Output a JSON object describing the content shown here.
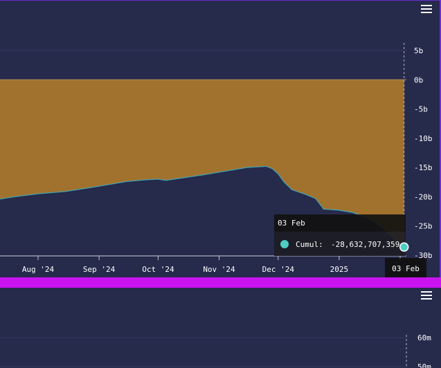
{
  "ui": {
    "menu_icon": "hamburger-icon",
    "colors": {
      "background": "#262a4b",
      "area_fill": "#a1722e",
      "series_fill": "#262a4b",
      "series_line": "#3fa7b8",
      "divider": "#c914f0",
      "tooltip_bg": "#111111",
      "marker": "#4ecdc4"
    }
  },
  "chart_data": [
    {
      "type": "area",
      "x_ticks": [
        "Aug '24",
        "Sep '24",
        "Oct '24",
        "Nov '24",
        "Dec '24",
        "2025",
        "Feb"
      ],
      "y_ticks": [
        "5b",
        "0b",
        "-5b",
        "-10b",
        "-15b",
        "-20b",
        "-25b",
        "-30b"
      ],
      "y_tick_values": [
        5,
        0,
        -5,
        -10,
        -15,
        -20,
        -25,
        -30
      ],
      "ylim": [
        -30,
        5
      ],
      "y_unit": "billions",
      "grid": true,
      "series": [
        {
          "points": [
            [
              "2024-07-12",
              -20.4
            ],
            [
              "2024-07-20",
              -20.0
            ],
            [
              "2024-08-01",
              -19.5
            ],
            [
              "2024-08-15",
              -19.1
            ],
            [
              "2024-09-01",
              -18.2
            ],
            [
              "2024-09-15",
              -17.4
            ],
            [
              "2024-09-25",
              -17.1
            ],
            [
              "2024-10-01",
              -17.0
            ],
            [
              "2024-10-05",
              -17.2
            ],
            [
              "2024-10-15",
              -16.7
            ],
            [
              "2024-10-25",
              -16.2
            ],
            [
              "2024-11-01",
              -15.8
            ],
            [
              "2024-11-10",
              -15.3
            ],
            [
              "2024-11-15",
              -15.0
            ],
            [
              "2024-11-20",
              -14.9
            ],
            [
              "2024-11-25",
              -14.8
            ],
            [
              "2024-11-28",
              -15.2
            ],
            [
              "2024-12-01",
              -16.1
            ],
            [
              "2024-12-04",
              -17.5
            ],
            [
              "2024-12-08",
              -18.8
            ],
            [
              "2024-12-15",
              -19.6
            ],
            [
              "2024-12-20",
              -20.3
            ],
            [
              "2024-12-23",
              -21.6
            ],
            [
              "2024-12-24",
              -22.1
            ],
            [
              "2025-01-01",
              -22.3
            ],
            [
              "2025-01-08",
              -22.7
            ],
            [
              "2025-01-15",
              -23.6
            ],
            [
              "2025-01-22",
              -25.0
            ],
            [
              "2025-01-29",
              -27.2
            ],
            [
              "2025-02-03",
              -28.6
            ]
          ]
        }
      ],
      "tooltip": {
        "date": "03 Feb",
        "label": "Cumul:",
        "value": "-28,632,707,359"
      },
      "crosshair_label": "03 Feb"
    },
    {
      "type": "line",
      "y_ticks": [
        "60m",
        "50m"
      ]
    }
  ]
}
